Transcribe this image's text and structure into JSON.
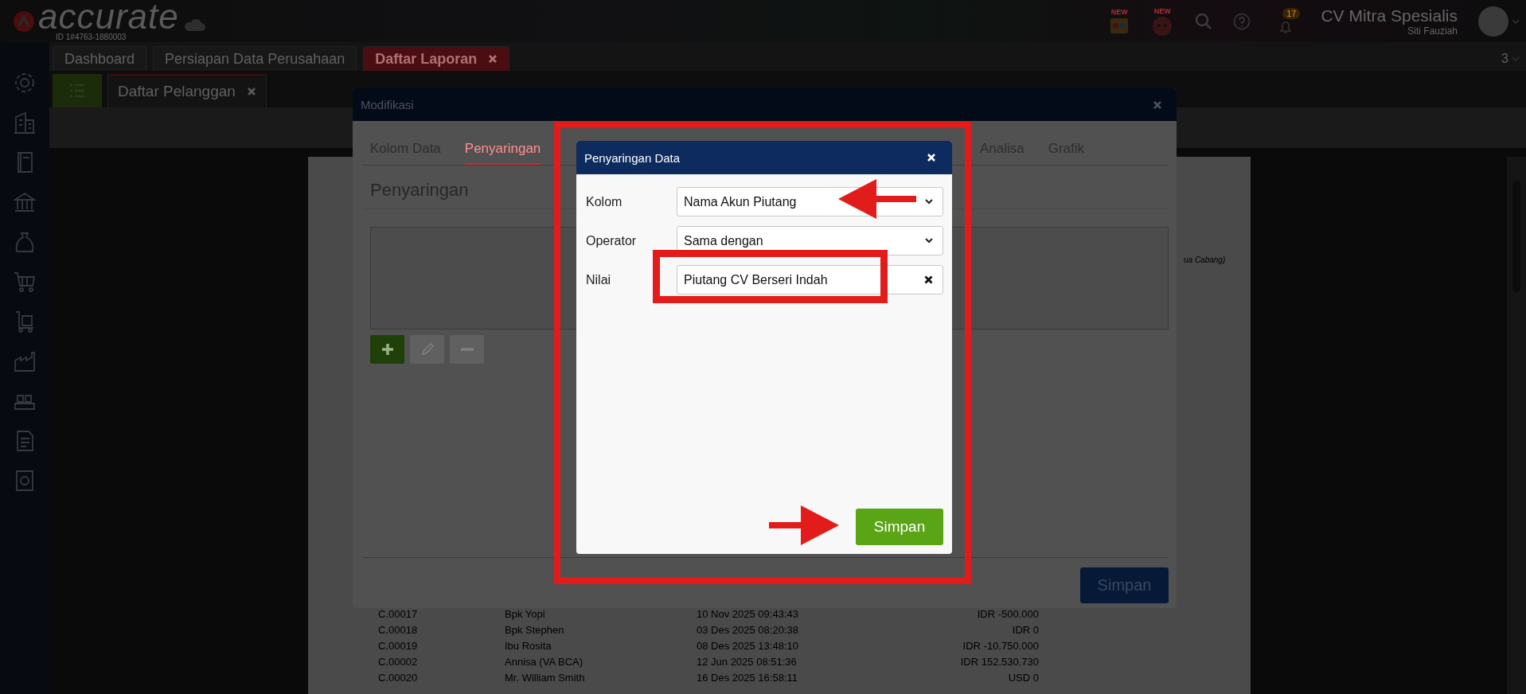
{
  "header": {
    "logo_text": "accurate",
    "logo_id": "ID 1#4763-1880003",
    "app_badges": [
      "NEW",
      "NEW"
    ],
    "notification_count": "17",
    "company": "CV Mitra Spesialis",
    "user": "Siti Fauziah"
  },
  "main_tabs": [
    {
      "label": "Dashboard",
      "selected": false,
      "closable": false
    },
    {
      "label": "Persiapan Data Perusahaan",
      "selected": false,
      "closable": false
    },
    {
      "label": "Daftar Laporan",
      "selected": true,
      "closable": true
    }
  ],
  "tab_counter": "3",
  "sub_tabs": [
    {
      "label": "Daftar Pelanggan",
      "selected": true,
      "closable": true
    }
  ],
  "report": {
    "subtitle_fragment": "ua Cabang)",
    "rows": [
      {
        "code": "C.00017",
        "name": "Bpk Yopi",
        "date": "10 Nov 2025 09:43:43",
        "balance": "IDR -500.000"
      },
      {
        "code": "C.00018",
        "name": "Bpk Stephen",
        "date": "03 Des 2025 08:20:38",
        "balance": "IDR 0"
      },
      {
        "code": "C.00019",
        "name": "Ibu Rosita",
        "date": "08 Des 2025 13:48:10",
        "balance": "IDR -10.750.000"
      },
      {
        "code": "C.00002",
        "name": "Annisa (VA BCA)",
        "date": "12 Jun 2025 08:51:36",
        "balance": "IDR 152.530.730"
      },
      {
        "code": "C.00020",
        "name": "Mr. William Smith",
        "date": "16 Des 2025 16:58:11",
        "balance": "USD 0"
      }
    ]
  },
  "modal": {
    "title": "Modifikasi",
    "tabs": [
      {
        "label": "Kolom Data",
        "selected": false
      },
      {
        "label": "Penyaringan",
        "selected": true
      },
      {
        "label": "Analisa",
        "selected": false
      },
      {
        "label": "Grafik",
        "selected": false
      }
    ],
    "section_title": "Penyaringan",
    "tools": [
      {
        "kind": "add",
        "disabled": false
      },
      {
        "kind": "edit",
        "disabled": true
      },
      {
        "kind": "remove",
        "disabled": true
      }
    ],
    "save_label": "Simpan"
  },
  "dialog": {
    "title": "Penyaringan Data",
    "fields": [
      {
        "label": "Kolom",
        "kind": "select",
        "value": "Nama Akun Piutang"
      },
      {
        "label": "Operator",
        "kind": "select",
        "value": "Sama dengan"
      },
      {
        "label": "Nilai",
        "kind": "text",
        "value": "Piutang CV Berseri Indah"
      }
    ],
    "save_label": "Simpan"
  }
}
